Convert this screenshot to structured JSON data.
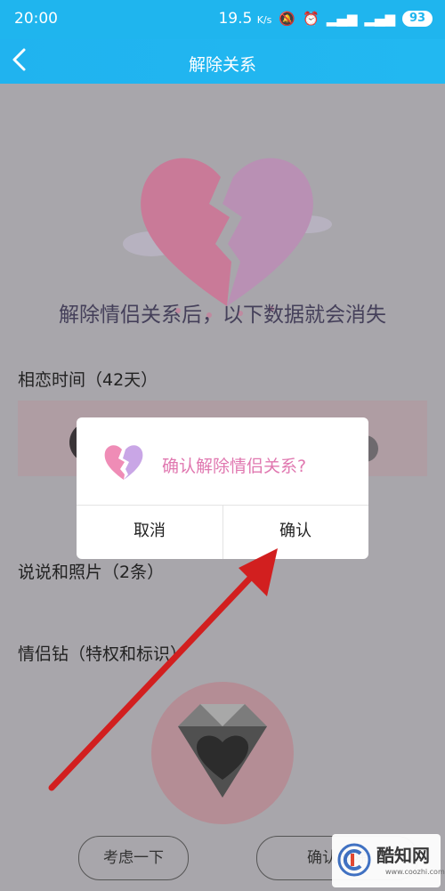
{
  "status_bar": {
    "time": "20:00",
    "speed": "19.5",
    "speed_unit": "K/s",
    "battery": "93",
    "icons": [
      "mute-icon",
      "alarm-icon",
      "signal-icon",
      "signal-icon",
      "wifi-icon"
    ]
  },
  "header": {
    "title": "解除关系"
  },
  "main": {
    "headline": "解除情侣关系后，以下数据就会消失",
    "sections": [
      {
        "label": "相恋时间（42天）"
      },
      {
        "label": "说说和照片（2条）"
      },
      {
        "label": "情侣钻（特权和标识）"
      }
    ]
  },
  "footer": {
    "reconsider_label": "考虑一下",
    "confirm_label": "确认解除"
  },
  "dialog": {
    "message": "确认解除情侣关系?",
    "cancel_label": "取消",
    "confirm_label": "确认"
  },
  "watermark": {
    "brand": "酷知网",
    "url": "www.coozhi.com"
  },
  "colors": {
    "header_bg": "#1fb5ee",
    "dialog_text": "#e078b0",
    "arrow": "#d21f1f",
    "overlay": "#a8a6ab"
  }
}
